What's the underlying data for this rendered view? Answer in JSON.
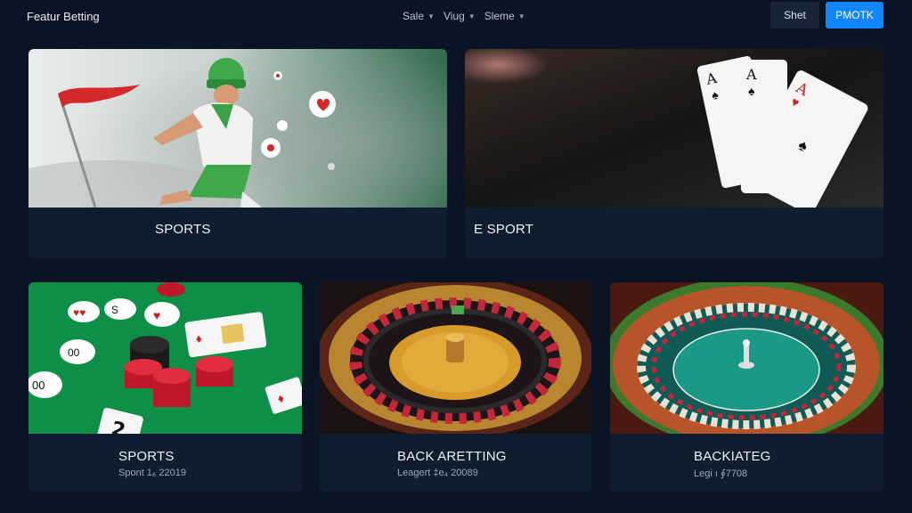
{
  "header": {
    "brand": "Featur Betting",
    "nav": [
      {
        "label": "Sale"
      },
      {
        "label": "Viug"
      },
      {
        "label": "Sleme"
      }
    ],
    "secondary_button": "Shet",
    "primary_button": "PMOTK"
  },
  "cards": [
    {
      "title": "SPORTS"
    },
    {
      "title": "E SPORT"
    },
    {
      "title": "SPORTS",
      "subtitle": "Spont 1₆ 22019"
    },
    {
      "title": "BACK ARETTING",
      "subtitle": "Leagert ‡e₄ 20089"
    },
    {
      "title": "BACKIATEG",
      "subtitle": "Legi ı ∮7708"
    }
  ],
  "colors": {
    "background": "#0a1424",
    "card": "#0f1d31",
    "accent": "#1186ff"
  },
  "icons": {
    "nav_dropdown": "chevron-down-icon"
  }
}
